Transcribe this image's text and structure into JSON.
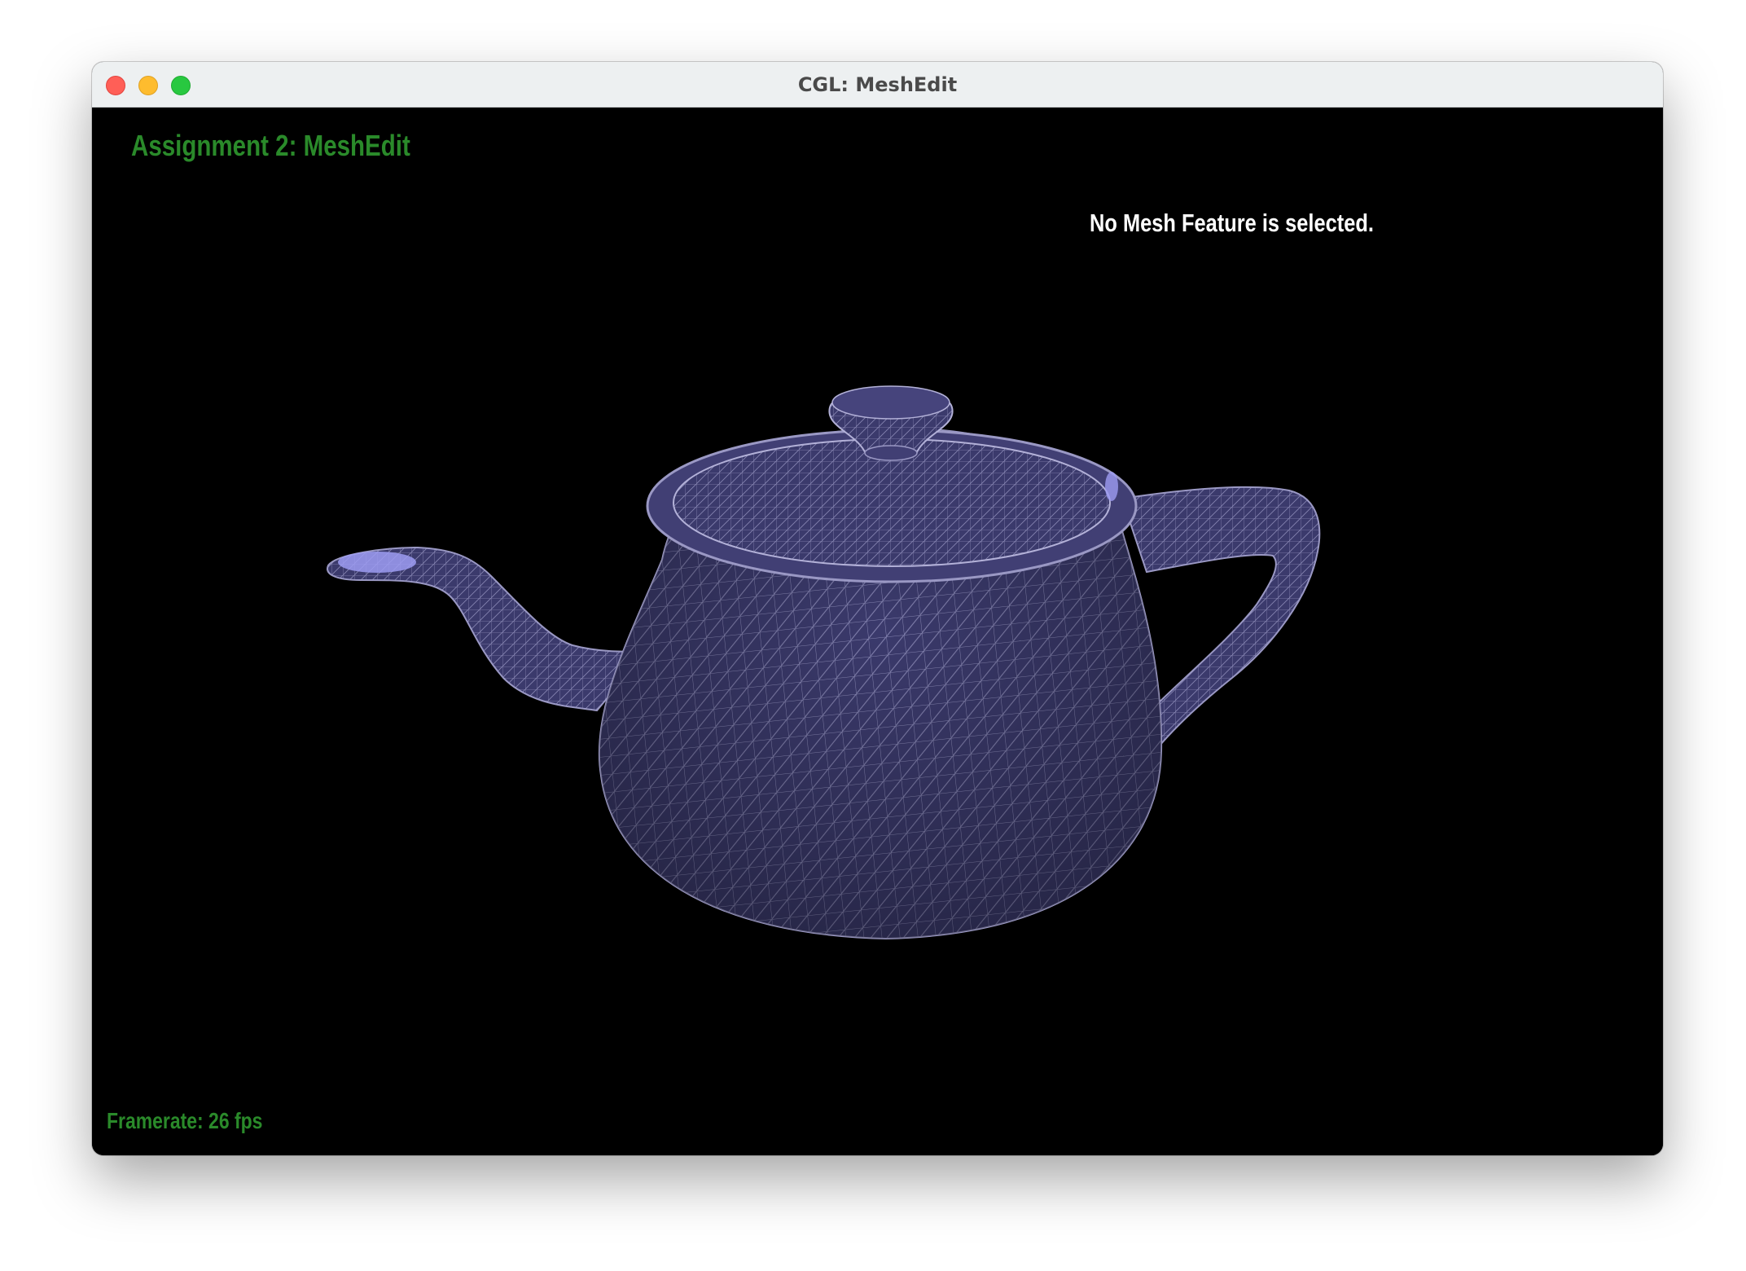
{
  "window": {
    "title": "CGL: MeshEdit"
  },
  "viewport": {
    "heading": "Assignment 2: MeshEdit",
    "selection_status": "No Mesh Feature is selected.",
    "framerate": "Framerate: 26 fps",
    "colors": {
      "background": "#000000",
      "mesh_fill": "#3b3a6c",
      "mesh_wire": "#9a98c4",
      "hole_highlight": "#9d9cf2",
      "hud_green": "#2a8a2a",
      "hud_white": "#ffffff"
    },
    "model": "teapot-mesh"
  }
}
